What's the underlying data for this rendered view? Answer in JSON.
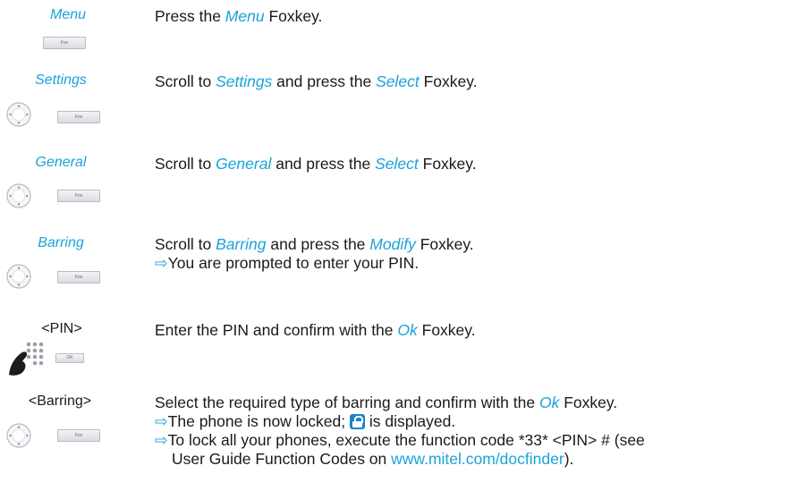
{
  "steps": [
    {
      "key": "Menu",
      "parts": [
        "Press the ",
        "Menu",
        " Foxkey."
      ],
      "fox": "Fox"
    },
    {
      "key": "Settings",
      "parts": [
        "Scroll to ",
        "Settings",
        " and press the ",
        "Select",
        " Foxkey."
      ],
      "fox": "Fox"
    },
    {
      "key": "General",
      "parts": [
        "Scroll to ",
        "General",
        " and press the ",
        "Select",
        " Foxkey."
      ],
      "fox": "Fox"
    },
    {
      "key": "Barring",
      "parts": [
        "Scroll to ",
        "Barring",
        " and press the ",
        "Modify",
        " Foxkey."
      ],
      "result1": "You are prompted to enter your PIN.",
      "fox": "Fox"
    },
    {
      "key": "<PIN>",
      "parts": [
        "Enter the PIN and confirm with the ",
        "Ok",
        " Foxkey."
      ],
      "fox": "OK"
    },
    {
      "key": "<Barring>",
      "parts": [
        "Select the required type of barring and confirm with the ",
        "Ok",
        " Foxkey."
      ],
      "result1a": "The phone is now locked; ",
      "result1b": " is displayed.",
      "result2a": "To lock all your phones, execute the function code *33* <PIN> # (see",
      "result2b": "User Guide Function Codes on ",
      "link": "www.mitel.com/docfinder",
      "result2c": ").",
      "fox": "Fox"
    }
  ],
  "icons": {
    "arrow": "⇨",
    "nav": "navigation-key-icon",
    "lock": "lock-icon",
    "keypad": "keypad-hand-icon"
  },
  "colors": {
    "accent": "#1aa3d9",
    "text": "#1a1a1a"
  }
}
